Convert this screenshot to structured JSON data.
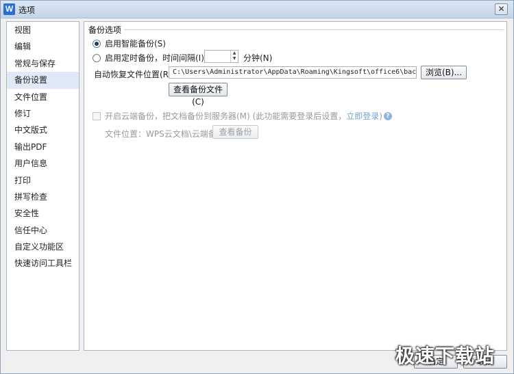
{
  "window": {
    "title": "选项",
    "app_icon_letter": "W",
    "close_glyph": "✕"
  },
  "sidebar": {
    "items": [
      {
        "label": "视图"
      },
      {
        "label": "编辑"
      },
      {
        "label": "常规与保存"
      },
      {
        "label": "备份设置",
        "selected": true
      },
      {
        "label": "文件位置"
      },
      {
        "label": "修订"
      },
      {
        "label": "中文版式"
      },
      {
        "label": "输出PDF"
      },
      {
        "label": "用户信息"
      },
      {
        "label": "打印"
      },
      {
        "label": "拼写检查"
      },
      {
        "label": "安全性"
      },
      {
        "label": "信任中心"
      },
      {
        "label": "自定义功能区"
      },
      {
        "label": "快速访问工具栏"
      }
    ]
  },
  "backup": {
    "group_title": "备份选项",
    "smart_backup_label": "启用智能备份(S)",
    "smart_backup_checked": true,
    "timed_backup_label": "启用定时备份，时间间隔(I):",
    "timed_backup_checked": false,
    "interval_value": "",
    "interval_unit": "分钟(N)",
    "recovery_path_label": "自动恢复文件位置(R):",
    "recovery_path_value": "C:\\Users\\Administrator\\AppData\\Roaming\\Kingsoft\\office6\\backup",
    "browse_button": "浏览(B)...",
    "view_backup_files_button": "查看备份文件(C)"
  },
  "cloud": {
    "enable_label": "开启云端备份，把文档备份到服务器(M) (此功能需要登录后设置，",
    "login_link": "立即登录",
    "enable_label_end": ")",
    "help_glyph": "?",
    "path_label": "文件位置：WPS云文档\\云端备份",
    "view_backup_button": "查看备份"
  },
  "footer": {
    "ok_button": "确定",
    "cancel_button": "取消"
  },
  "watermark": "极速下载站",
  "colors": {
    "selected_bg": "#dfe9f7",
    "link": "#7ba4d6",
    "title_bar": "#c4d4e8"
  }
}
